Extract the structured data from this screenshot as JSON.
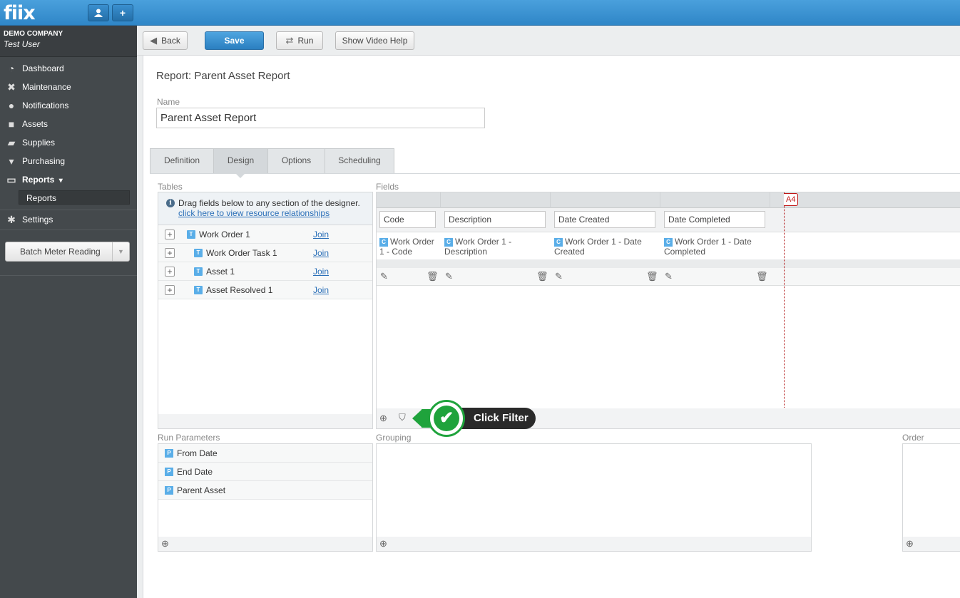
{
  "app": {
    "logo": "fiix",
    "user_icon": "user-icon",
    "add_icon": "plus-icon",
    "add_label": "+"
  },
  "sidebar": {
    "company": "DEMO COMPANY",
    "user": "Test User",
    "items": [
      {
        "label": "Dashboard",
        "icon": "dashboard-icon",
        "glyph": "◔"
      },
      {
        "label": "Maintenance",
        "icon": "tools-icon",
        "glyph": "✖"
      },
      {
        "label": "Notifications",
        "icon": "speech-bubble-icon",
        "glyph": "●"
      },
      {
        "label": "Assets",
        "icon": "box-icon",
        "glyph": "■"
      },
      {
        "label": "Supplies",
        "icon": "truck-icon",
        "glyph": "▰"
      },
      {
        "label": "Purchasing",
        "icon": "cart-icon",
        "glyph": "▾"
      },
      {
        "label": "Reports",
        "icon": "chart-icon",
        "glyph": "▭"
      },
      {
        "label": "Settings",
        "icon": "gear-icon",
        "glyph": "✱"
      }
    ],
    "reports_caret": "▾",
    "sub_item": "Reports",
    "batch_button": "Batch Meter Reading",
    "batch_caret": "▼"
  },
  "toolbar": {
    "back": "Back",
    "back_glyph": "◀",
    "save": "Save",
    "run": "Run",
    "run_glyph": "⇄",
    "help": "Show Video Help"
  },
  "report": {
    "title": "Report: Parent Asset Report",
    "name_label": "Name",
    "name_value": "Parent Asset Report"
  },
  "tabs": [
    "Definition",
    "Design",
    "Options",
    "Scheduling"
  ],
  "tables": {
    "label": "Tables",
    "info_text": "Drag fields below to any section of the designer.",
    "info_link": "click here to view resource relationships",
    "info_glyph": "i",
    "rows": [
      {
        "name": "Work Order 1",
        "join": "Join"
      },
      {
        "name": "Work Order Task 1",
        "join": "Join"
      },
      {
        "name": "Asset 1",
        "join": "Join"
      },
      {
        "name": "Asset Resolved 1",
        "join": "Join"
      }
    ],
    "expand_glyph": "+",
    "table_glyph": "T"
  },
  "fields": {
    "label": "Fields",
    "a4": "A4",
    "col_glyph": "C",
    "edit_glyph": "✎",
    "delete_glyph": "🗑",
    "columns": [
      {
        "label": "Code",
        "value": "Work Order 1 - Code"
      },
      {
        "label": "Description",
        "value": "Work Order 1 - Description"
      },
      {
        "label": "Date Created",
        "value": "Work Order 1 - Date Created"
      },
      {
        "label": "Date Completed",
        "value": "Work Order 1 - Date Completed"
      }
    ],
    "add_glyph": "⊕",
    "filter_glyph": "⛉"
  },
  "callout": {
    "text": "Click Filter",
    "check": "✔"
  },
  "run_parameters": {
    "label": "Run Parameters",
    "param_glyph": "P",
    "items": [
      "From Date",
      "End Date",
      "Parent Asset"
    ]
  },
  "grouping": {
    "label": "Grouping"
  },
  "order": {
    "label": "Order"
  }
}
